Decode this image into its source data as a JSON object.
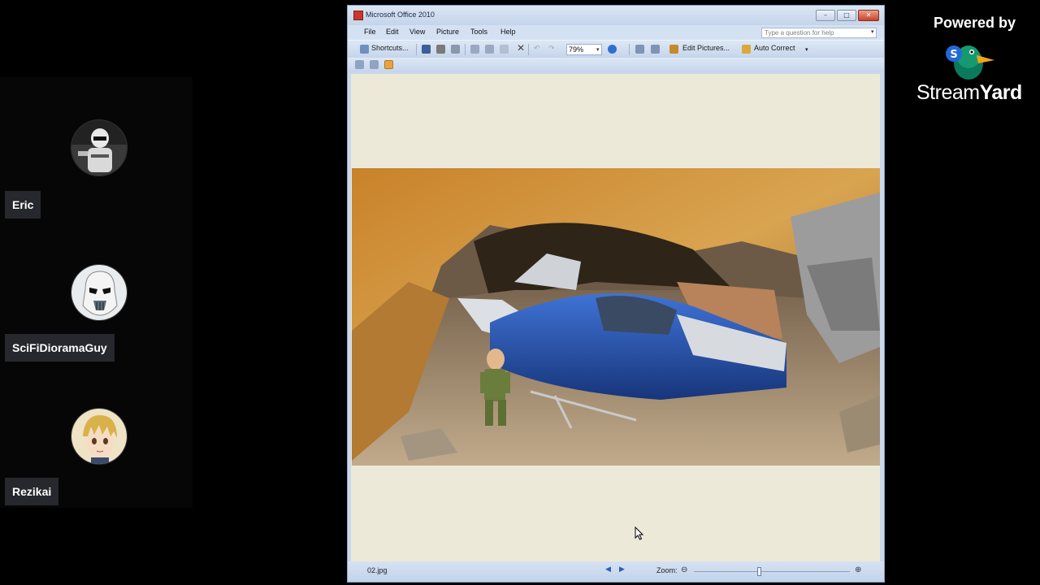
{
  "participants": [
    {
      "name": "Eric",
      "avatar": "stormtrooper-scout-avatar"
    },
    {
      "name": "SciFiDioramaGuy",
      "avatar": "stormtrooper-helmet-avatar"
    },
    {
      "name": "Rezikai",
      "avatar": "anime-character-avatar"
    }
  ],
  "branding": {
    "powered_by": "Powered by",
    "name_light": "Stream",
    "name_bold": "Yard",
    "logo_icon": "streamyard-duck-logo"
  },
  "window": {
    "title": "Microsoft Office 2010",
    "controls": {
      "minimize": "–",
      "maximize": "□",
      "close": "✕"
    }
  },
  "menu": {
    "items": [
      "File",
      "Edit",
      "View",
      "Picture",
      "Tools",
      "Help"
    ],
    "help_placeholder": "Type a question for help"
  },
  "toolbar": {
    "shortcuts_label": "Shortcuts...",
    "zoom_value": "79%",
    "edit_pictures_label": "Edit Pictures...",
    "auto_correct_label": "Auto Correct"
  },
  "canvas": {
    "image_description_icon": "diorama-photo",
    "background_color": "#ece9d9"
  },
  "status": {
    "filename": "02.jpg",
    "zoom_label": "Zoom:",
    "zoom_level": 0.42
  },
  "colors": {
    "titlebar": "#c4d4ea",
    "close_button": "#c8432b",
    "name_tag": "#27282d"
  }
}
